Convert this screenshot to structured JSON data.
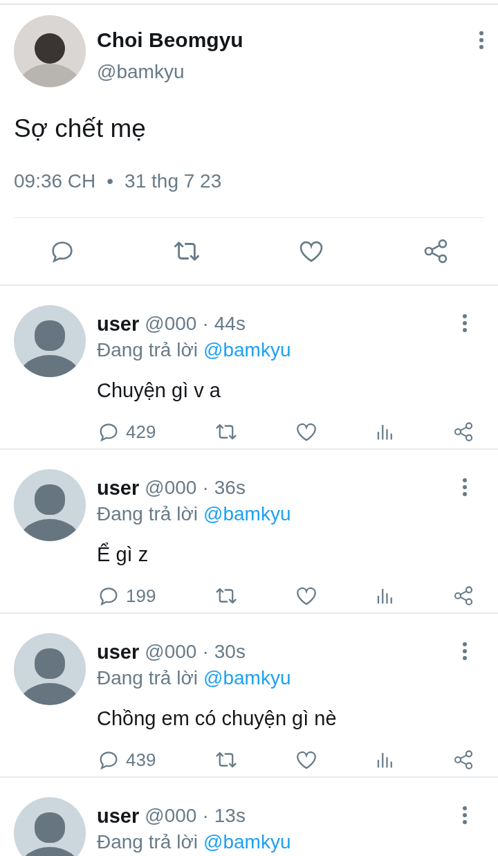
{
  "tweet": {
    "name": "Choi Beomgyu",
    "handle": "@bamkyu",
    "text": "Sợ chết mẹ",
    "time": "09:36 CH",
    "separator": "•",
    "date": "31 thg 7 23"
  },
  "replies": [
    {
      "name": "user",
      "handle": "@000",
      "separator": "·",
      "age": "44s",
      "replying_prefix": "Đang trả lời",
      "replying_to": "@bamkyu",
      "text": "Chuyện gì v a",
      "reply_count": "429"
    },
    {
      "name": "user",
      "handle": "@000",
      "separator": "·",
      "age": "36s",
      "replying_prefix": "Đang trả lời",
      "replying_to": "@bamkyu",
      "text": "Ể gì z",
      "reply_count": "199"
    },
    {
      "name": "user",
      "handle": "@000",
      "separator": "·",
      "age": "30s",
      "replying_prefix": "Đang trả lời",
      "replying_to": "@bamkyu",
      "text": "Chồng em có chuyện gì nè",
      "reply_count": "439"
    },
    {
      "name": "user",
      "handle": "@000",
      "separator": "·",
      "age": "13s",
      "replying_prefix": "Đang trả lời",
      "replying_to": "@bamkyu"
    }
  ]
}
